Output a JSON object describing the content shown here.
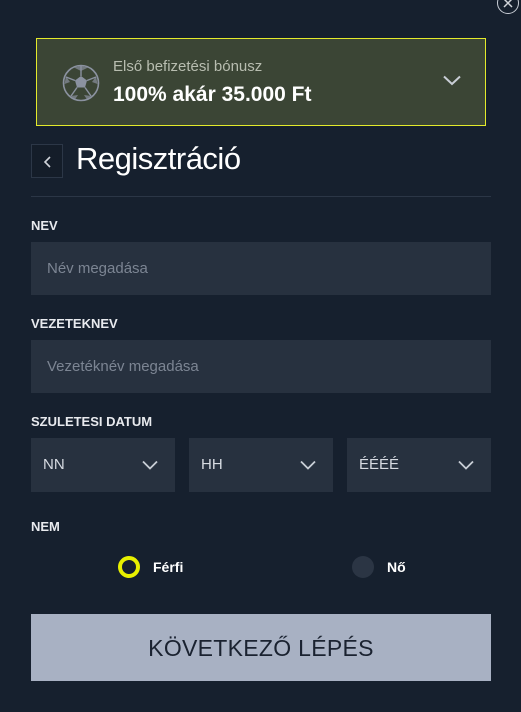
{
  "bonus": {
    "label": "Első befizetési bónusz",
    "value": "100% akár 35.000 Ft",
    "icon": "soccer-ball-icon",
    "border_color": "#e3ea2b"
  },
  "header": {
    "title": "Regisztráció",
    "back_icon": "chevron-left-icon"
  },
  "form": {
    "first_name": {
      "label": "NEV",
      "placeholder": "Név megadása"
    },
    "last_name": {
      "label": "VEZETEKNEV",
      "placeholder": "Vezetéknév megadása"
    },
    "birth_date": {
      "label": "SZULETESI DATUM",
      "day": "NN",
      "month": "HH",
      "year": "ÉÉÉÉ"
    },
    "gender": {
      "label": "NEM",
      "options": [
        {
          "label": "Férfi",
          "selected": true
        },
        {
          "label": "Nő",
          "selected": false
        }
      ]
    }
  },
  "next_button": {
    "label": "KÖVETKEZŐ LÉPÉS"
  },
  "colors": {
    "background": "#16202e",
    "input": "#27313f",
    "accent": "#e8f000",
    "button": "#a8b1c3"
  }
}
